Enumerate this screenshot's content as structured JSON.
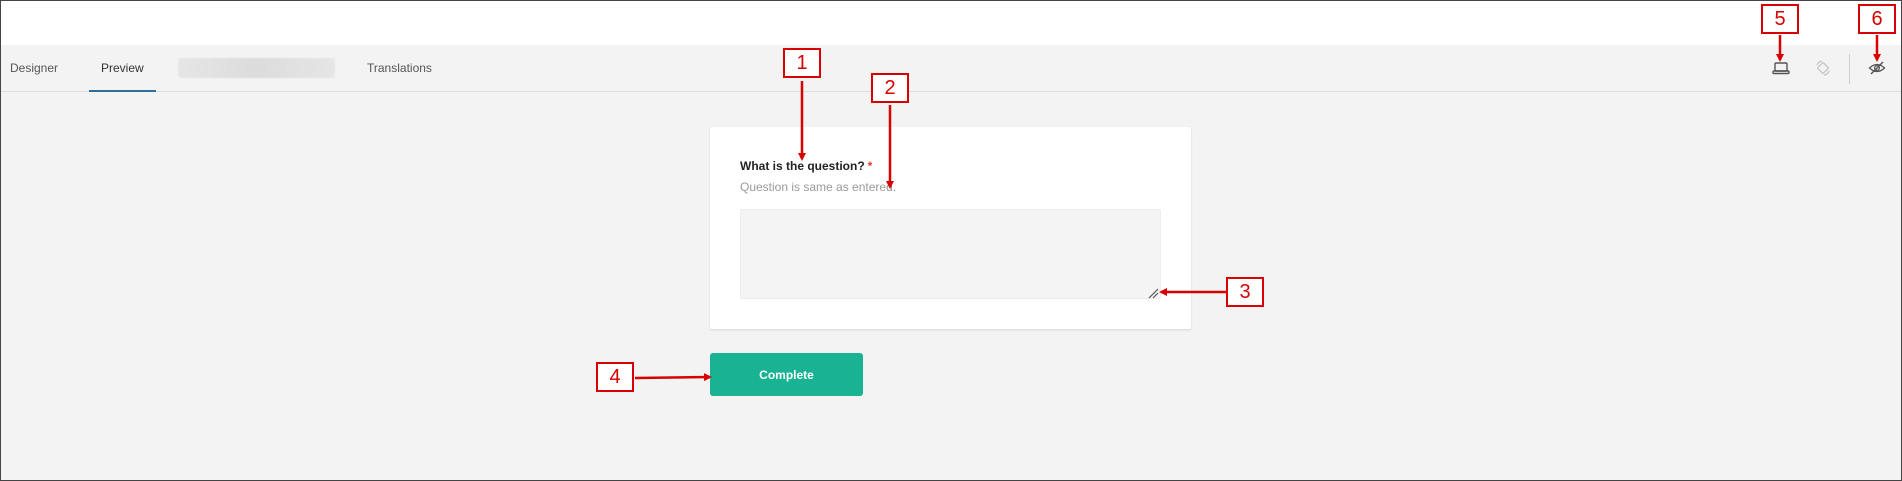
{
  "tabs": [
    {
      "label": "Designer",
      "active": false
    },
    {
      "label": "Preview",
      "active": true
    },
    {
      "label": "",
      "blurred": true
    },
    {
      "label": "Translations",
      "active": false
    }
  ],
  "toolbar": {
    "icons": [
      "device-icon",
      "orientation-icon",
      "hide-invisible-icon"
    ]
  },
  "question": {
    "title": "What is the question?",
    "required_mark": "*",
    "description": "Question is same as entered.",
    "value": ""
  },
  "complete_button": {
    "label": "Complete"
  },
  "annotations": [
    "1",
    "2",
    "3",
    "4",
    "5",
    "6"
  ],
  "colors": {
    "accent": "#19b394",
    "tab_underline": "#2b6f9a",
    "required": "#e53935",
    "annotation": "#d80000",
    "background": "#f3f3f3"
  }
}
